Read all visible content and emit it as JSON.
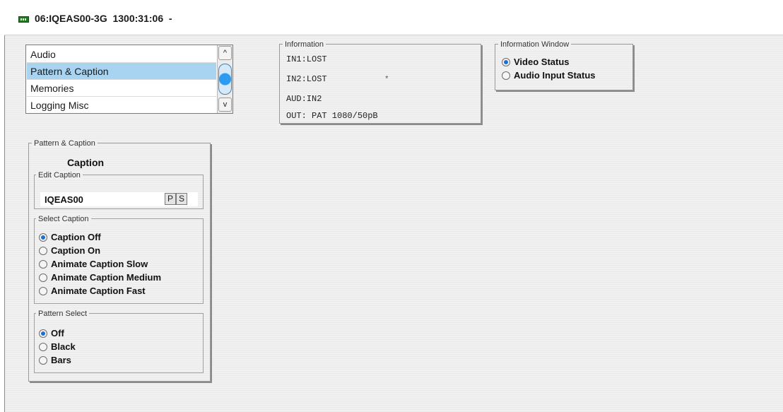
{
  "window": {
    "title": "06:IQEAS00-3G  1300:31:06  -"
  },
  "menu": {
    "items": [
      {
        "label": "Audio",
        "selected": false
      },
      {
        "label": "Pattern & Caption",
        "selected": true
      },
      {
        "label": "Memories",
        "selected": false
      },
      {
        "label": "Logging Misc",
        "selected": false
      }
    ],
    "scroll_up_glyph": "^",
    "scroll_down_glyph": "v"
  },
  "information": {
    "title": "Information",
    "lines": [
      "IN1:LOST",
      "IN2:LOST",
      "AUD:IN2",
      "OUT: PAT 1080/50pB"
    ],
    "marker": "*"
  },
  "info_window": {
    "title": "Information Window",
    "options": [
      {
        "label": "Video Status",
        "checked": true
      },
      {
        "label": "Audio Input Status",
        "checked": false
      }
    ]
  },
  "pattern_caption": {
    "title": "Pattern & Caption",
    "heading": "Caption",
    "edit_caption": {
      "title": "Edit Caption",
      "value": "IQEAS00",
      "p_label": "P",
      "s_label": "S"
    },
    "select_caption": {
      "title": "Select Caption",
      "options": [
        {
          "label": "Caption Off",
          "checked": true
        },
        {
          "label": "Caption On",
          "checked": false
        },
        {
          "label": "Animate Caption Slow",
          "checked": false
        },
        {
          "label": "Animate Caption Medium",
          "checked": false
        },
        {
          "label": "Animate Caption Fast",
          "checked": false
        }
      ]
    },
    "pattern_select": {
      "title": "Pattern Select",
      "options": [
        {
          "label": "Off",
          "checked": true
        },
        {
          "label": "Black",
          "checked": false
        },
        {
          "label": "Bars",
          "checked": false
        }
      ]
    }
  },
  "colors": {
    "selection": "#a8d4f2",
    "radio_dot": "#1f6fd0",
    "title_icon": "#1f7a1f"
  }
}
